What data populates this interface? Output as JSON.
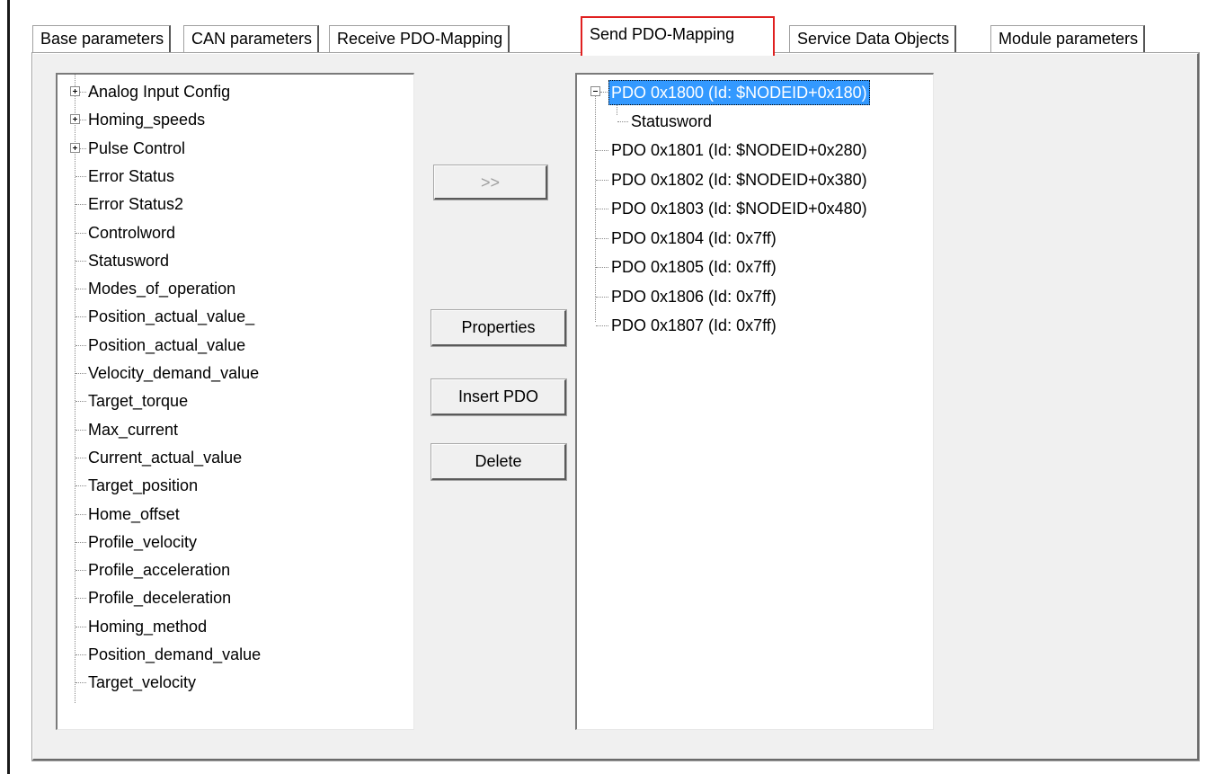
{
  "tabs": [
    {
      "label": "Base parameters",
      "active": false
    },
    {
      "label": "CAN parameters",
      "active": false
    },
    {
      "label": "Receive PDO-Mapping",
      "active": false
    },
    {
      "label": "Send PDO-Mapping",
      "active": true
    },
    {
      "label": "Service Data Objects",
      "active": false
    },
    {
      "label": "Module parameters",
      "active": false
    }
  ],
  "left_tree": {
    "items": [
      {
        "label": "Analog Input Config",
        "expandable": true
      },
      {
        "label": "Homing_speeds",
        "expandable": true
      },
      {
        "label": "Pulse Control",
        "expandable": true
      },
      {
        "label": "Error Status",
        "expandable": false
      },
      {
        "label": "Error Status2",
        "expandable": false
      },
      {
        "label": "Controlword",
        "expandable": false
      },
      {
        "label": "Statusword",
        "expandable": false
      },
      {
        "label": "Modes_of_operation",
        "expandable": false
      },
      {
        "label": "Position_actual_value_",
        "expandable": false
      },
      {
        "label": "Position_actual_value",
        "expandable": false
      },
      {
        "label": "Velocity_demand_value",
        "expandable": false
      },
      {
        "label": "Target_torque",
        "expandable": false
      },
      {
        "label": "Max_current",
        "expandable": false
      },
      {
        "label": "Current_actual_value",
        "expandable": false
      },
      {
        "label": "Target_position",
        "expandable": false
      },
      {
        "label": "Home_offset",
        "expandable": false
      },
      {
        "label": "Profile_velocity",
        "expandable": false
      },
      {
        "label": "Profile_acceleration",
        "expandable": false
      },
      {
        "label": "Profile_deceleration",
        "expandable": false
      },
      {
        "label": "Homing_method",
        "expandable": false
      },
      {
        "label": "Position_demand_value",
        "expandable": false
      },
      {
        "label": "Target_velocity",
        "expandable": false
      }
    ]
  },
  "buttons": {
    "move": {
      "label": ">>",
      "enabled": false
    },
    "properties": {
      "label": "Properties"
    },
    "insert_pdo": {
      "label": "Insert PDO"
    },
    "delete": {
      "label": "Delete"
    }
  },
  "right_tree": {
    "pdos": [
      {
        "label": "PDO 0x1800 (Id: $NODEID+0x180)",
        "selected": true,
        "expanded": true,
        "children": [
          "Statusword"
        ]
      },
      {
        "label": "PDO 0x1801 (Id: $NODEID+0x280)",
        "selected": false
      },
      {
        "label": "PDO 0x1802 (Id: $NODEID+0x380)",
        "selected": false
      },
      {
        "label": "PDO 0x1803 (Id: $NODEID+0x480)",
        "selected": false
      },
      {
        "label": "PDO 0x1804 (Id: 0x7ff)",
        "selected": false
      },
      {
        "label": "PDO 0x1805 (Id: 0x7ff)",
        "selected": false
      },
      {
        "label": "PDO 0x1806 (Id: 0x7ff)",
        "selected": false
      },
      {
        "label": "PDO 0x1807 (Id: 0x7ff)",
        "selected": false
      }
    ]
  },
  "colors": {
    "selection": "#3399ff",
    "active_tab_outline": "#e02020",
    "panel_background": "#f0f0f0"
  }
}
